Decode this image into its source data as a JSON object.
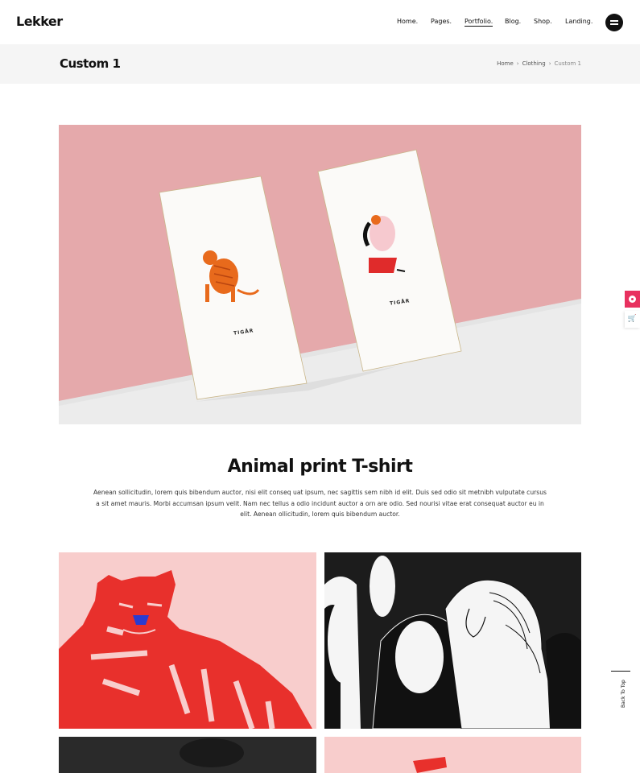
{
  "header": {
    "logo": "Lekker",
    "nav": [
      {
        "label": "Home.",
        "active": false
      },
      {
        "label": "Pages.",
        "active": false
      },
      {
        "label": "Portfolio.",
        "active": true
      },
      {
        "label": "Blog.",
        "active": false
      },
      {
        "label": "Shop.",
        "active": false
      },
      {
        "label": "Landing.",
        "active": false
      }
    ],
    "menu_icon": "hamburger-icon"
  },
  "titlebar": {
    "title": "Custom 1",
    "breadcrumb": [
      "Home",
      "Clothing",
      "Custom 1"
    ]
  },
  "hero": {
    "card_left_label": "TIGÅR",
    "card_right_label": "TIGÅR",
    "colors": {
      "wall": "#e5a9ab",
      "floor": "#ececec",
      "tiger": "#e86a1c",
      "accent_red": "#e02b2b"
    }
  },
  "content": {
    "title": "Animal print T-shirt",
    "paragraph": "Aenean sollicitudin, lorem quis bibendum auctor, nisi elit conseq uat ipsum, nec sagittis sem nibh id elit. Duis sed odio sit metnibh vulputate cursus a sit amet mauris. Morbi accumsan ipsum velit. Nam nec tellus a odio incidunt auctor a orn are odio. Sed nourisi vitae erat consequat auctor eu in elit. Aenean ollicitudin, lorem quis bibendum auctor."
  },
  "gallery": {
    "colors": {
      "pink": "#f8cdcc",
      "red": "#e8302c",
      "dark": "#222222"
    }
  },
  "side": {
    "widget_1_icon": "demo-icon",
    "widget_2_icon": "cart-icon",
    "back_to_top": "Back To Top"
  }
}
